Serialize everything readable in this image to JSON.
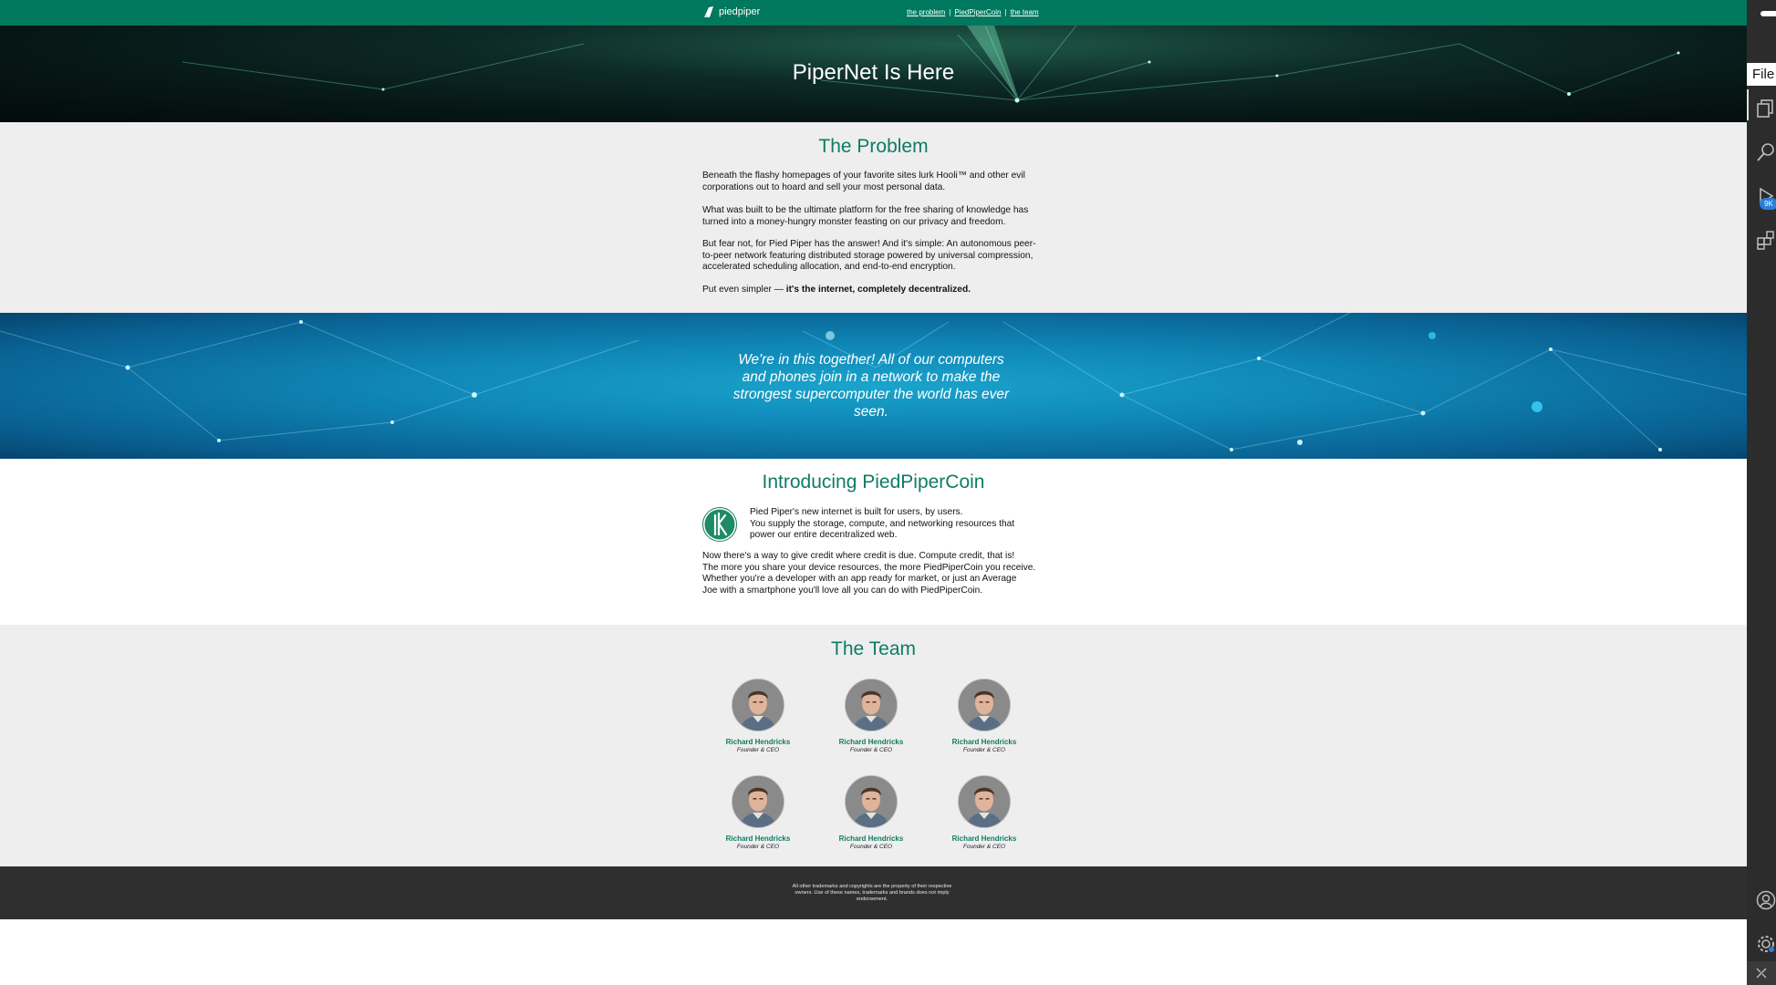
{
  "nav": {
    "brand": "piedpiper",
    "links": [
      "the problem",
      "PiedPiperCoin",
      "the team"
    ],
    "separator": "|"
  },
  "hero": {
    "title": "PiperNet Is Here"
  },
  "problem": {
    "title": "The Problem",
    "paragraphs": [
      "Beneath the flashy homepages of your favorite sites lurk Hooli™ and other evil corporations out to hoard and sell your most personal data.",
      "What was built to be the ultimate platform for the free sharing of knowledge has turned into a money-hungry monster feasting on our privacy and freedom.",
      "But fear not, for Pied Piper has the answer! And it's simple: An autonomous peer-to-peer network featuring distributed storage powered by universal compression, accelerated scheduling allocation, and end-to-end encryption."
    ],
    "last_prefix": "Put even simpler — ",
    "last_bold": "it's the internet, completely decentralized."
  },
  "banner": {
    "quote": "We're in this together! All of our computers and phones join in a network to make the strongest supercomputer the world has ever seen."
  },
  "coin": {
    "title": "Introducing PiedPiperCoin",
    "intro_lines": [
      "Pied Piper's new internet is built for users, by users.",
      "You supply the storage, compute, and networking resources that power our entire decentralized web."
    ],
    "body_lines": [
      "Now there's a way to give credit where credit is due. Compute credit, that is!",
      "The more you share your device resources, the more PiedPiperCoin you receive. Whether you're a developer with an app ready for market, or just an Average",
      "Joe with a smartphone you'll love all you can do with PiedPiperCoin."
    ]
  },
  "team": {
    "title": "The Team",
    "members": [
      {
        "name": "Richard Hendricks",
        "role": "Founder & CEO"
      },
      {
        "name": "Richard Hendricks",
        "role": "Founder & CEO"
      },
      {
        "name": "Richard Hendricks",
        "role": "Founder & CEO"
      },
      {
        "name": "Richard Hendricks",
        "role": "Founder & CEO"
      },
      {
        "name": "Richard Hendricks",
        "role": "Founder & CEO"
      },
      {
        "name": "Richard Hendricks",
        "role": "Founder & CEO"
      }
    ]
  },
  "footer": {
    "text": "All other trademarks and copyrights are the property of their respective owners. Use of these names, trademarks and brands does not imply endorsement."
  },
  "sidebar": {
    "file_tab": "File",
    "badge": "9K",
    "icons": [
      "explorer-icon",
      "search-icon",
      "run-debug-icon",
      "extensions-icon",
      "account-icon",
      "settings-gear-icon",
      "remote-icon"
    ]
  },
  "colors": {
    "brand_green": "#00785e",
    "heading_green": "#0f7c63",
    "section_gray": "#eeeeee",
    "footer_dark": "#2f2f2f",
    "sidebar_dark": "#2c2c2c",
    "badge_blue": "#2d7fd6"
  }
}
